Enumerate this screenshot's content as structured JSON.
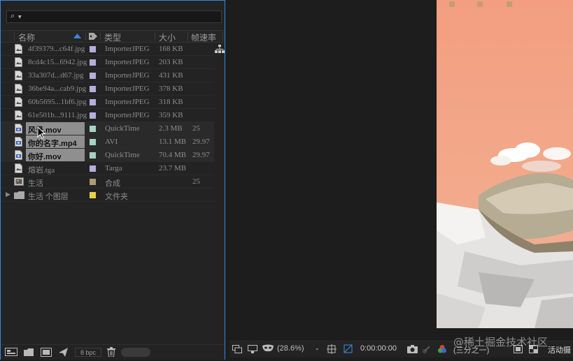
{
  "project": {
    "search": {
      "placeholder": ""
    },
    "columns": {
      "name": "名称",
      "type": "类型",
      "size": "大小",
      "fps": "帧速率"
    },
    "items": [
      {
        "name": "4f39379...c64f.jpg",
        "type": "ImporterJPEG",
        "size": "168 KB",
        "fps": "",
        "label_color": "#b3b0d9",
        "icon": "image-file-icon",
        "selected": false
      },
      {
        "name": "8cd4c15...6942.jpg",
        "type": "ImporterJPEG",
        "size": "203 KB",
        "fps": "",
        "label_color": "#b3b0d9",
        "icon": "image-file-icon",
        "selected": false
      },
      {
        "name": "33a307d...d67.jpg",
        "type": "ImporterJPEG",
        "size": "431 KB",
        "fps": "",
        "label_color": "#b3b0d9",
        "icon": "image-file-icon",
        "selected": false
      },
      {
        "name": "36be94a...cab9.jpg",
        "type": "ImporterJPEG",
        "size": "378 KB",
        "fps": "",
        "label_color": "#b3b0d9",
        "icon": "image-file-icon",
        "selected": false
      },
      {
        "name": "60b5695...1bf6.jpg",
        "type": "ImporterJPEG",
        "size": "318 KB",
        "fps": "",
        "label_color": "#b3b0d9",
        "icon": "image-file-icon",
        "selected": false
      },
      {
        "name": "61e501b...9111.jpg",
        "type": "ImporterJPEG",
        "size": "359 KB",
        "fps": "",
        "label_color": "#b3b0d9",
        "icon": "image-file-icon",
        "selected": false
      },
      {
        "name": "风景.mov",
        "type": "QuickTime",
        "size": "2.3 MB",
        "fps": "25",
        "label_color": "#a6d3c4",
        "icon": "video-file-icon",
        "selected": true
      },
      {
        "name": "你的名字.mp4",
        "type": "AVI",
        "size": "13.1 MB",
        "fps": "29.97",
        "label_color": "#a6d3c4",
        "icon": "video-file-icon",
        "selected": true
      },
      {
        "name": "你好.mov",
        "type": "QuickTime",
        "size": "70.4 MB",
        "fps": "29.97",
        "label_color": "#a6d3c4",
        "icon": "video-file-icon",
        "selected": true
      },
      {
        "name": "熔岩.tga",
        "type": "Targa",
        "size": "23.7 MB",
        "fps": "",
        "label_color": "#b3b0d9",
        "icon": "image-file-icon",
        "selected": false
      },
      {
        "name": "生活",
        "type": "合成",
        "size": "",
        "fps": "25",
        "label_color": "#b09a7a",
        "icon": "composition-icon",
        "selected": false
      },
      {
        "name": "生活 个图层",
        "type": "文件夹",
        "size": "",
        "fps": "",
        "label_color": "#e6d24a",
        "icon": "folder-icon",
        "selected": false
      }
    ],
    "footer": {
      "bpc": "8 bpc"
    }
  },
  "viewer": {
    "zoom": "(28.6%)",
    "timecode": "0:00:00:00",
    "resolution": "(三分之一)",
    "active_camera": "活动摄"
  },
  "watermark": "@稀土掘金技术社区",
  "colors": {
    "panel_focus": "#2d8ceb",
    "background": "#1d1d1d"
  }
}
